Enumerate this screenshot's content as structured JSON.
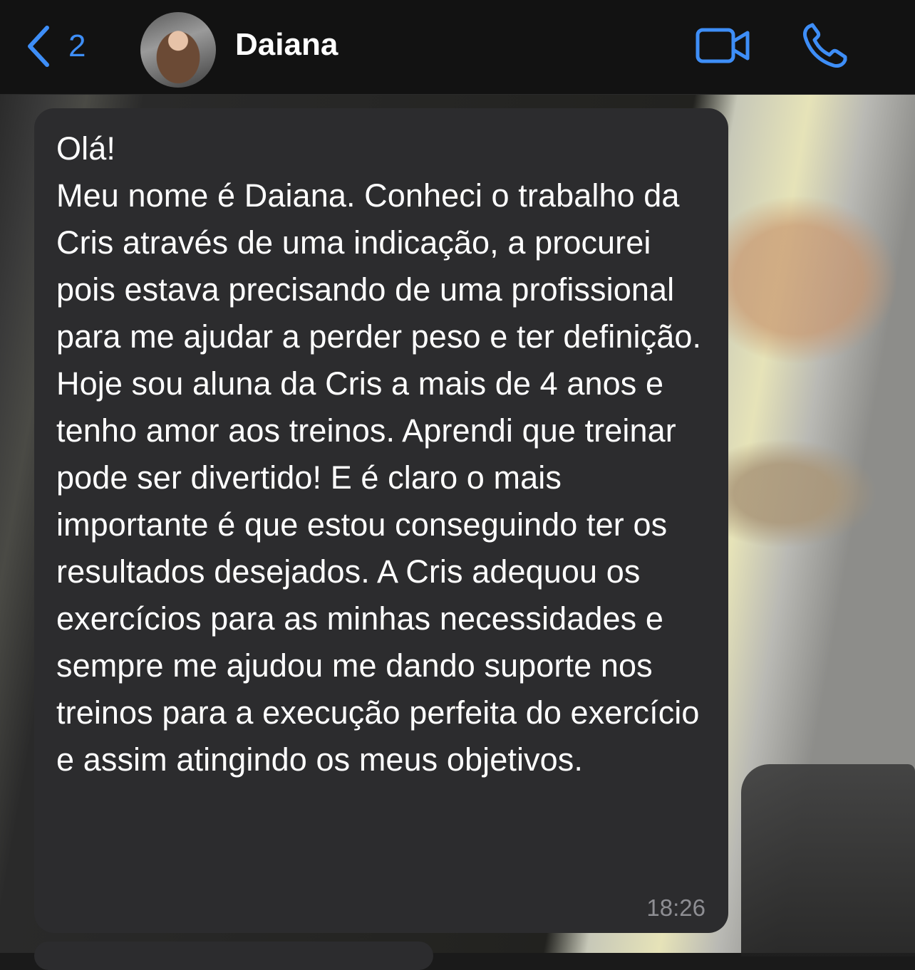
{
  "header": {
    "back_count": "2",
    "contact_name": "Daiana",
    "icons": {
      "back": "chevron-left-icon",
      "video": "video-camera-icon",
      "call": "phone-icon"
    },
    "accent_color": "#3e8ef7"
  },
  "message": {
    "text": "Olá!\nMeu nome é Daiana. Conheci o trabalho da Cris através de uma indicação, a procurei pois estava precisando de uma profissional para me ajudar a perder peso e ter definição.\nHoje sou aluna da Cris a mais de 4 anos e tenho amor aos treinos. Aprendi que treinar pode ser divertido! E é claro o mais importante é que estou conseguindo ter os resultados desejados. A Cris adequou os exercícios para as minhas necessidades e sempre me ajudou me dando suporte nos treinos para a execução perfeita do exercício e assim atingindo os meus objetivos.",
    "time": "18:26"
  }
}
